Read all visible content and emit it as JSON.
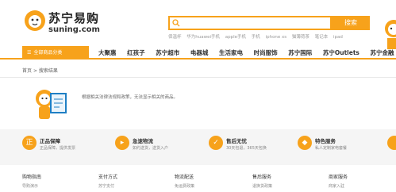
{
  "brand": {
    "name_cn": "苏宁易购",
    "name_en": "suning.com",
    "color": "#f7a21b"
  },
  "search": {
    "placeholder": "",
    "button_label": "搜索",
    "hot_words": [
      "保温杯",
      "华为huawei手机",
      "apple手机",
      "手机",
      "iphone xs",
      "猫薄荷茶",
      "笔记本",
      "ipad"
    ]
  },
  "nav": {
    "all_categories": "全部商品分类",
    "items": [
      "大聚惠",
      "红孩子",
      "苏宁超市",
      "电器城",
      "生活家电",
      "时尚服饰",
      "苏宁国际",
      "苏宁Outlets",
      "苏宁金融"
    ]
  },
  "breadcrumb": {
    "home": "首页",
    "separator": ">",
    "current": "搜索结果"
  },
  "empty_result": {
    "message": "根据相关法律法规和政策，无法显示相关的商品。"
  },
  "services": [
    {
      "icon": "shield-check-icon",
      "title": "正品保障",
      "desc": "正品保障，提供发票"
    },
    {
      "icon": "delivery-truck-icon",
      "title": "急速物流",
      "desc": "如约送货，送货入户"
    },
    {
      "icon": "thumbs-up-icon",
      "title": "售后无忧",
      "desc": "30天包退，365天包换"
    },
    {
      "icon": "gift-icon",
      "title": "特色服务",
      "desc": "私人定制家电套餐"
    }
  ],
  "footer": {
    "columns": [
      {
        "heading": "购物指南",
        "first_link": "导购演示"
      },
      {
        "heading": "支付方式",
        "first_link": "苏宁支付"
      },
      {
        "heading": "物流配送",
        "first_link": "免运费政策"
      },
      {
        "heading": "售后服务",
        "first_link": "退换货政策"
      },
      {
        "heading": "商家服务",
        "first_link": "商家入驻"
      }
    ]
  }
}
